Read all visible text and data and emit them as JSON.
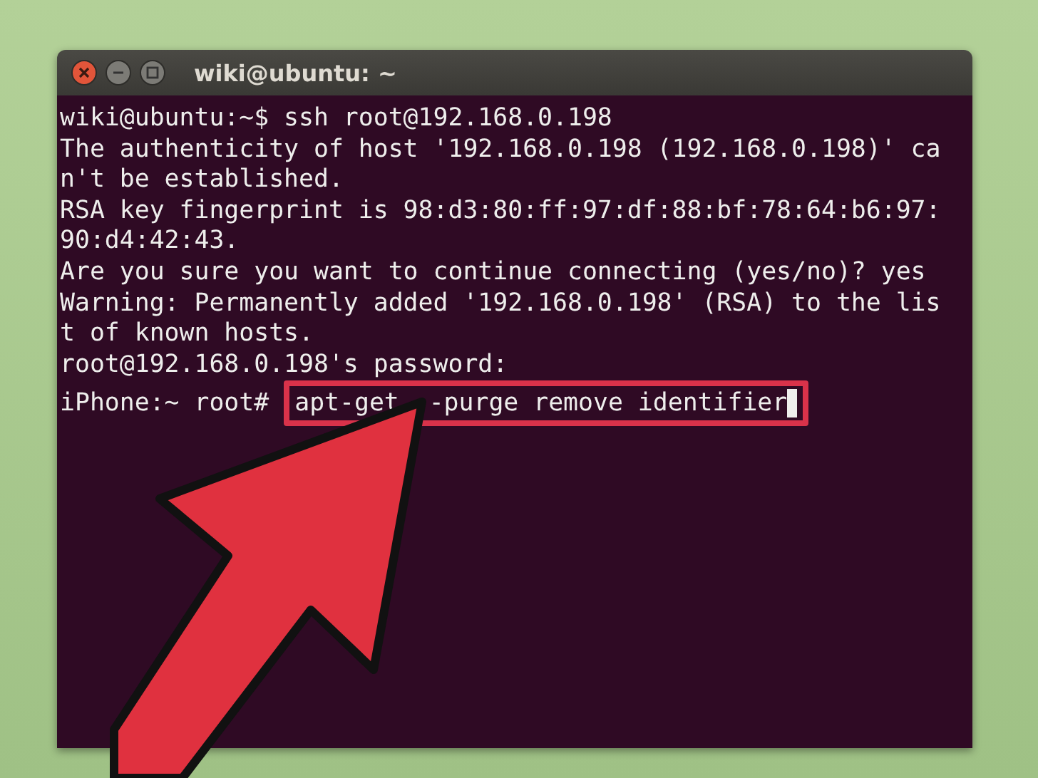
{
  "window": {
    "title": "wiki@ubuntu: ~"
  },
  "terminal": {
    "lines": [
      "wiki@ubuntu:~$ ssh root@192.168.0.198",
      "The authenticity of host '192.168.0.198 (192.168.0.198)' ca",
      "n't be established.",
      "RSA key fingerprint is 98:d3:80:ff:97:df:88:bf:78:64:b6:97:",
      "90:d4:42:43.",
      "Are you sure you want to continue connecting (yes/no)? yes",
      "Warning: Permanently added '192.168.0.198' (RSA) to the lis",
      "t of known hosts.",
      "root@192.168.0.198's password:"
    ],
    "prompt": "iPhone:~ root#",
    "command": "apt-get  -purge remove identifier",
    "highlighted": true
  }
}
